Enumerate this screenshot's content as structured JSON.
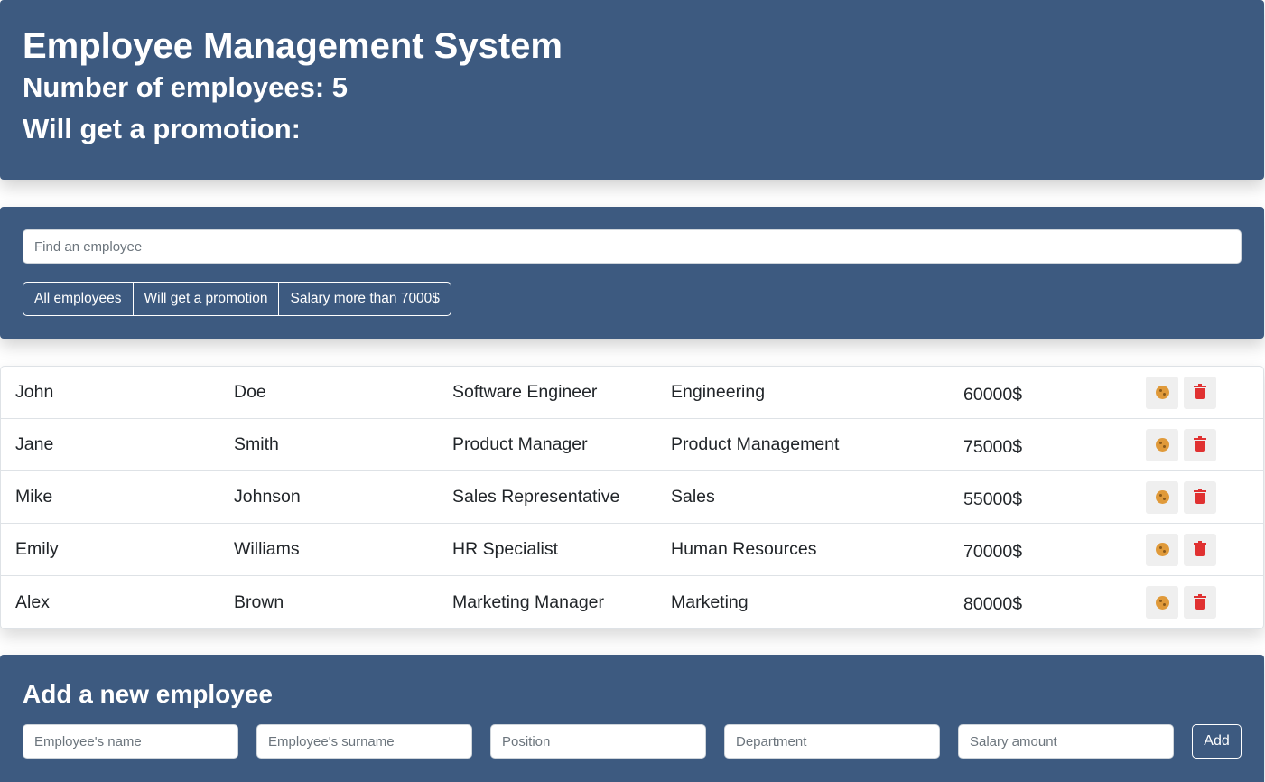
{
  "header": {
    "title": "Employee Management System",
    "count_text": "Number of employees: 5",
    "promotion_text": "Will get a promotion:"
  },
  "search": {
    "placeholder": "Find an employee",
    "value": ""
  },
  "filters": [
    {
      "label": "All employees"
    },
    {
      "label": "Will get a promotion"
    },
    {
      "label": "Salary more than 7000$"
    }
  ],
  "employees": [
    {
      "name": "John",
      "surname": "Doe",
      "position": "Software Engineer",
      "department": "Engineering",
      "salary": "60000$"
    },
    {
      "name": "Jane",
      "surname": "Smith",
      "position": "Product Manager",
      "department": "Product Management",
      "salary": "75000$"
    },
    {
      "name": "Mike",
      "surname": "Johnson",
      "position": "Sales Representative",
      "department": "Sales",
      "salary": "55000$"
    },
    {
      "name": "Emily",
      "surname": "Williams",
      "position": "HR Specialist",
      "department": "Human Resources",
      "salary": "70000$"
    },
    {
      "name": "Alex",
      "surname": "Brown",
      "position": "Marketing Manager",
      "department": "Marketing",
      "salary": "80000$"
    }
  ],
  "add_form": {
    "title": "Add a new employee",
    "name_placeholder": "Employee's name",
    "surname_placeholder": "Employee's surname",
    "position_placeholder": "Position",
    "department_placeholder": "Department",
    "salary_placeholder": "Salary amount",
    "add_label": "Add"
  },
  "icons": {
    "promote": "cookie-icon",
    "delete": "trash-icon"
  },
  "colors": {
    "panel": "#3d5a80",
    "cookie": "#e09a3a",
    "trash": "#e03131"
  }
}
